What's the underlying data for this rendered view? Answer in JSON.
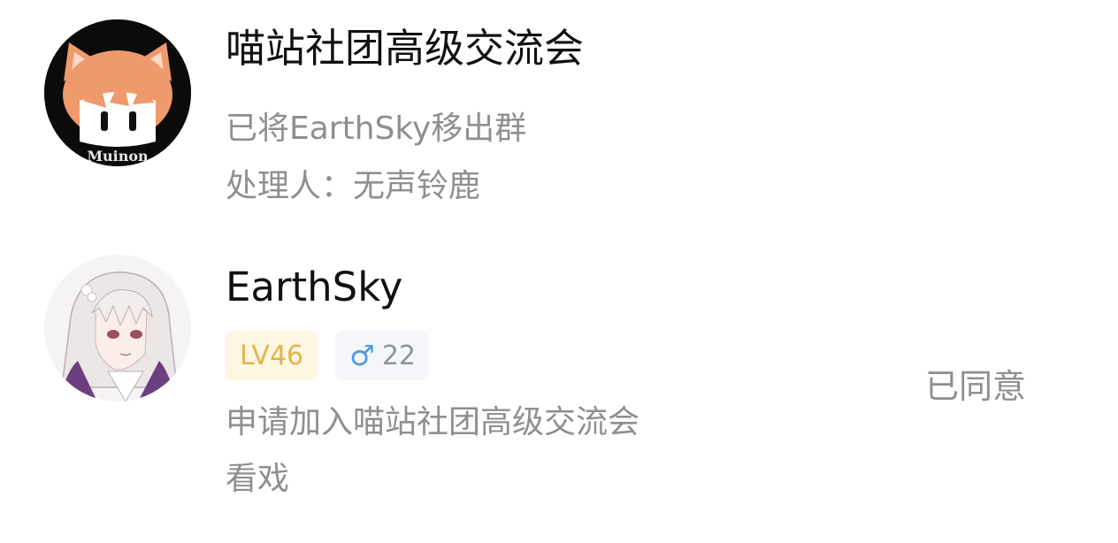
{
  "notifications": [
    {
      "group_name": "喵站社团高级交流会",
      "avatar_logo_text": "Muinon",
      "message": "已将EarthSky移出群",
      "handler": "处理人：无声铃鹿"
    },
    {
      "user_name": "EarthSky",
      "level": "LV46",
      "gender_icon": "♂",
      "age": "22",
      "request_text": "申请加入喵站社团高级交流会",
      "remark": "看戏",
      "status": "已同意"
    }
  ],
  "colors": {
    "title": "#111111",
    "secondary_text": "#8f8f8f",
    "level_badge_bg": "#fdf6e2",
    "level_badge_text": "#e2b54d",
    "gender_badge_bg": "#f4f6f9",
    "male_icon": "#4d9be0"
  }
}
